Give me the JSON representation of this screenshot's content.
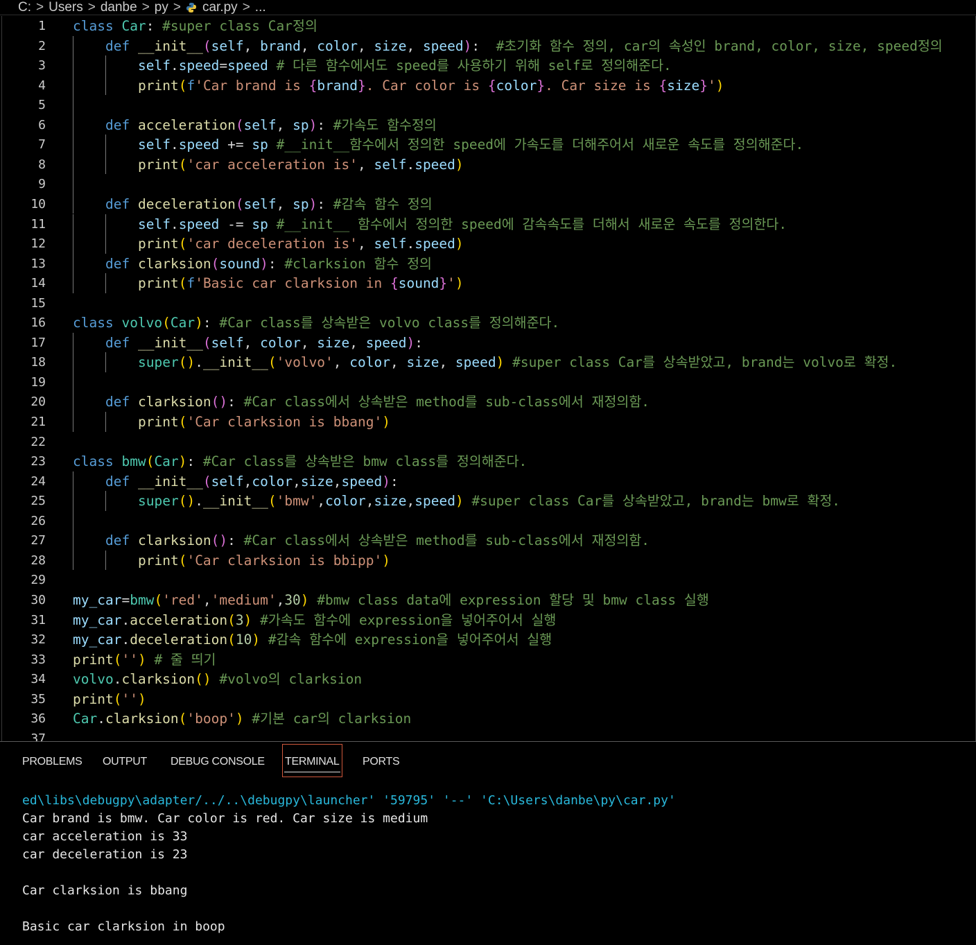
{
  "breadcrumb": {
    "parts": [
      "C:",
      "Users",
      "danbe",
      "py"
    ],
    "file": "car.py",
    "more": "...",
    "separator": ">"
  },
  "editor": {
    "lines": [
      {
        "n": "1",
        "indent": 0,
        "html": "<span class='kw'>class</span> <span class='cls'>Car</span>: <span class='cm'>#super class Car정의</span>"
      },
      {
        "n": "2",
        "indent": 1,
        "html": "<span class='kw'>def</span> <span class='fn'>__init__</span><span class='br2'>(</span><span class='par'>self</span>, <span class='par'>brand</span>, <span class='par'>color</span>, <span class='par'>size</span>, <span class='par'>speed</span><span class='br2'>)</span>:  <span class='cm'>#초기화 함수 정의, car의 속성인 brand, color, size, speed정의</span>"
      },
      {
        "n": "3",
        "indent": 2,
        "html": "<span class='par'>self</span>.<span class='par'>speed</span>=<span class='par'>speed</span> <span class='cm'># 다른 함수에서도 speed를 사용하기 위해 self로 정의해준다.</span>"
      },
      {
        "n": "4",
        "indent": 2,
        "html": "<span class='fn'>print</span><span class='br1'>(</span><span class='kw'>f</span><span class='str'>'Car brand is </span><span class='br2'>{</span><span class='par'>brand</span><span class='br2'>}</span><span class='str'>. Car color is </span><span class='br2'>{</span><span class='par'>color</span><span class='br2'>}</span><span class='str'>. Car size is </span><span class='br2'>{</span><span class='par'>size</span><span class='br2'>}</span><span class='str'>'</span><span class='br1'>)</span>"
      },
      {
        "n": "5",
        "indent": 1,
        "html": ""
      },
      {
        "n": "6",
        "indent": 1,
        "html": "<span class='kw'>def</span> <span class='fn'>acceleration</span><span class='br2'>(</span><span class='par'>self</span>, <span class='par'>sp</span><span class='br2'>)</span>: <span class='cm'>#가속도 함수정의</span>"
      },
      {
        "n": "7",
        "indent": 2,
        "html": "<span class='par'>self</span>.<span class='par'>speed</span> += <span class='par'>sp</span> <span class='cm'>#__init__함수에서 정의한 speed에 가속도를 더해주어서 새로운 속도를 정의해준다.</span>"
      },
      {
        "n": "8",
        "indent": 2,
        "html": "<span class='fn'>print</span><span class='br1'>(</span><span class='str'>'car acceleration is'</span>, <span class='par'>self</span>.<span class='par'>speed</span><span class='br1'>)</span>"
      },
      {
        "n": "9",
        "indent": 1,
        "html": ""
      },
      {
        "n": "10",
        "indent": 1,
        "html": "<span class='kw'>def</span> <span class='fn'>deceleration</span><span class='br2'>(</span><span class='par'>self</span>, <span class='par'>sp</span><span class='br2'>)</span>: <span class='cm'>#감속 함수 정의</span>"
      },
      {
        "n": "11",
        "indent": 2,
        "html": "<span class='par'>self</span>.<span class='par'>speed</span> -= <span class='par'>sp</span> <span class='cm'>#__init__ 함수에서 정의한 speed에 감속속도를 더해서 새로운 속도를 정의한다.</span>"
      },
      {
        "n": "12",
        "indent": 2,
        "html": "<span class='fn'>print</span><span class='br1'>(</span><span class='str'>'car deceleration is'</span>, <span class='par'>self</span>.<span class='par'>speed</span><span class='br1'>)</span>"
      },
      {
        "n": "13",
        "indent": 1,
        "html": "<span class='kw'>def</span> <span class='fn'>clarksion</span><span class='br2'>(</span><span class='par'>sound</span><span class='br2'>)</span>: <span class='cm'>#clarksion 함수 정의</span>"
      },
      {
        "n": "14",
        "indent": 2,
        "html": "<span class='fn'>print</span><span class='br1'>(</span><span class='kw'>f</span><span class='str'>'Basic car clarksion in </span><span class='br2'>{</span><span class='par'>sound</span><span class='br2'>}</span><span class='str'>'</span><span class='br1'>)</span>"
      },
      {
        "n": "15",
        "indent": 0,
        "html": ""
      },
      {
        "n": "16",
        "indent": 0,
        "html": "<span class='kw'>class</span> <span class='cls'>volvo</span><span class='br1'>(</span><span class='cls'>Car</span><span class='br1'>)</span>: <span class='cm'>#Car class를 상속받은 volvo class를 정의해준다.</span>"
      },
      {
        "n": "17",
        "indent": 1,
        "html": "<span class='kw'>def</span> <span class='fn'>__init__</span><span class='br2'>(</span><span class='par'>self</span>, <span class='par'>color</span>, <span class='par'>size</span>, <span class='par'>speed</span><span class='br2'>)</span>:"
      },
      {
        "n": "18",
        "indent": 2,
        "html": "<span class='cls'>super</span><span class='br1'>()</span>.<span class='fn'>__init__</span><span class='br1'>(</span><span class='str'>'volvo'</span>, <span class='par'>color</span>, <span class='par'>size</span>, <span class='par'>speed</span><span class='br1'>)</span> <span class='cm'>#super class Car를 상속받았고, brand는 volvo로 확정.</span>"
      },
      {
        "n": "19",
        "indent": 1,
        "html": ""
      },
      {
        "n": "20",
        "indent": 1,
        "html": "<span class='kw'>def</span> <span class='fn'>clarksion</span><span class='br2'>()</span>: <span class='cm'>#Car class에서 상속받은 method를 sub-class에서 재정의함.</span>"
      },
      {
        "n": "21",
        "indent": 2,
        "html": "<span class='fn'>print</span><span class='br1'>(</span><span class='str'>'Car clarksion is bbang'</span><span class='br1'>)</span>"
      },
      {
        "n": "22",
        "indent": 0,
        "html": ""
      },
      {
        "n": "23",
        "indent": 0,
        "html": "<span class='kw'>class</span> <span class='cls'>bmw</span><span class='br1'>(</span><span class='cls'>Car</span><span class='br1'>)</span>: <span class='cm'>#Car class를 상속받은 bmw class를 정의해준다.</span>"
      },
      {
        "n": "24",
        "indent": 1,
        "html": "<span class='kw'>def</span> <span class='fn'>__init__</span><span class='br2'>(</span><span class='par'>self</span>,<span class='par'>color</span>,<span class='par'>size</span>,<span class='par'>speed</span><span class='br2'>)</span>:"
      },
      {
        "n": "25",
        "indent": 2,
        "html": "<span class='cls'>super</span><span class='br1'>()</span>.<span class='fn'>__init__</span><span class='br1'>(</span><span class='str'>'bmw'</span>,<span class='par'>color</span>,<span class='par'>size</span>,<span class='par'>speed</span><span class='br1'>)</span> <span class='cm'>#super class Car를 상속받았고, brand는 bmw로 확정.</span>"
      },
      {
        "n": "26",
        "indent": 1,
        "html": ""
      },
      {
        "n": "27",
        "indent": 1,
        "html": "<span class='kw'>def</span> <span class='fn'>clarksion</span><span class='br2'>()</span>: <span class='cm'>#Car class에서 상속받은 method를 sub-class에서 재정의함.</span>"
      },
      {
        "n": "28",
        "indent": 2,
        "html": "<span class='fn'>print</span><span class='br1'>(</span><span class='str'>'Car clarksion is bbipp'</span><span class='br1'>)</span>"
      },
      {
        "n": "29",
        "indent": 0,
        "html": ""
      },
      {
        "n": "30",
        "indent": 0,
        "html": "<span class='par'>my_car</span>=<span class='cls'>bmw</span><span class='br1'>(</span><span class='str'>'red'</span>,<span class='str'>'medium'</span>,<span class='num'>30</span><span class='br1'>)</span> <span class='cm'>#bmw class data에 expression 할당 및 bmw class 실행</span>"
      },
      {
        "n": "31",
        "indent": 0,
        "html": "<span class='par'>my_car</span>.<span class='fn'>acceleration</span><span class='br1'>(</span><span class='num'>3</span><span class='br1'>)</span> <span class='cm'>#가속도 함수에 expression을 넣어주어서 실행</span>"
      },
      {
        "n": "32",
        "indent": 0,
        "html": "<span class='par'>my_car</span>.<span class='fn'>deceleration</span><span class='br1'>(</span><span class='num'>10</span><span class='br1'>)</span> <span class='cm'>#감속 함수에 expression을 넣어주어서 실행</span>"
      },
      {
        "n": "33",
        "indent": 0,
        "html": "<span class='fn'>print</span><span class='br1'>(</span><span class='str'>''</span><span class='br1'>)</span> <span class='cm'># 줄 띄기</span>"
      },
      {
        "n": "34",
        "indent": 0,
        "html": "<span class='cls'>volvo</span>.<span class='fn'>clarksion</span><span class='br1'>()</span> <span class='cm'>#volvo의 clarksion</span>"
      },
      {
        "n": "35",
        "indent": 0,
        "html": "<span class='fn'>print</span><span class='br1'>(</span><span class='str'>''</span><span class='br1'>)</span>"
      },
      {
        "n": "36",
        "indent": 0,
        "html": "<span class='cls'>Car</span>.<span class='fn'>clarksion</span><span class='br1'>(</span><span class='str'>'boop'</span><span class='br1'>)</span> <span class='cm'>#기본 car의 clarksion</span>"
      },
      {
        "n": "37",
        "indent": 0,
        "html": ""
      }
    ]
  },
  "panel": {
    "tabs": [
      "PROBLEMS",
      "OUTPUT",
      "DEBUG CONSOLE",
      "TERMINAL",
      "PORTS"
    ],
    "active_tab": "TERMINAL"
  },
  "terminal": {
    "lines": [
      {
        "text": "ed\\libs\\debugpy\\adapter/../..\\debugpy\\launcher' '59795' '--' 'C:\\Users\\danbe\\py\\car.py'",
        "cls": "cyan"
      },
      {
        "text": "Car brand is bmw. Car color is red. Car size is medium",
        "cls": ""
      },
      {
        "text": "car acceleration is 33",
        "cls": ""
      },
      {
        "text": "car deceleration is 23",
        "cls": ""
      },
      {
        "text": "",
        "cls": ""
      },
      {
        "text": "Car clarksion is bbang",
        "cls": ""
      },
      {
        "text": "",
        "cls": ""
      },
      {
        "text": "Basic car clarksion in boop",
        "cls": ""
      }
    ]
  },
  "colors": {
    "keyword": "#569cd6",
    "function": "#dcdcaa",
    "class": "#4ec9b0",
    "param": "#9cdcfe",
    "string": "#ce9178",
    "comment": "#6a9955",
    "number": "#b5cea8",
    "active_tab_border": "#d0583c",
    "terminal_path": "#29b8db"
  }
}
